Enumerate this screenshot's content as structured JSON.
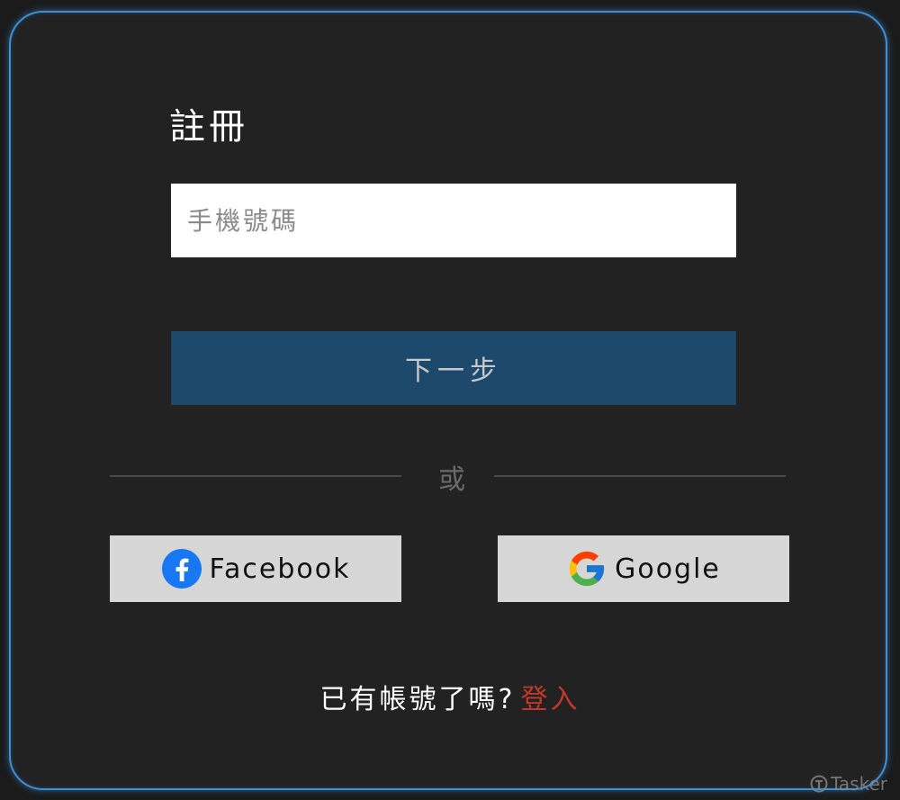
{
  "form": {
    "title": "註冊",
    "phone_placeholder": "手機號碼",
    "phone_value": "",
    "next_label": "下一步",
    "divider_label": "或"
  },
  "social": {
    "facebook_label": "Facebook",
    "facebook_icon": "facebook-icon",
    "google_label": "Google",
    "google_icon": "google-icon"
  },
  "footer": {
    "prompt": "已有帳號了嗎?",
    "login_link": "登入"
  },
  "watermark": {
    "text": "Tasker"
  },
  "colors": {
    "frame_border": "#3d8fd6",
    "background": "#222222",
    "primary_button": "#1d4a6c",
    "social_button": "#d6d6d6",
    "login_link": "#c0392b"
  }
}
